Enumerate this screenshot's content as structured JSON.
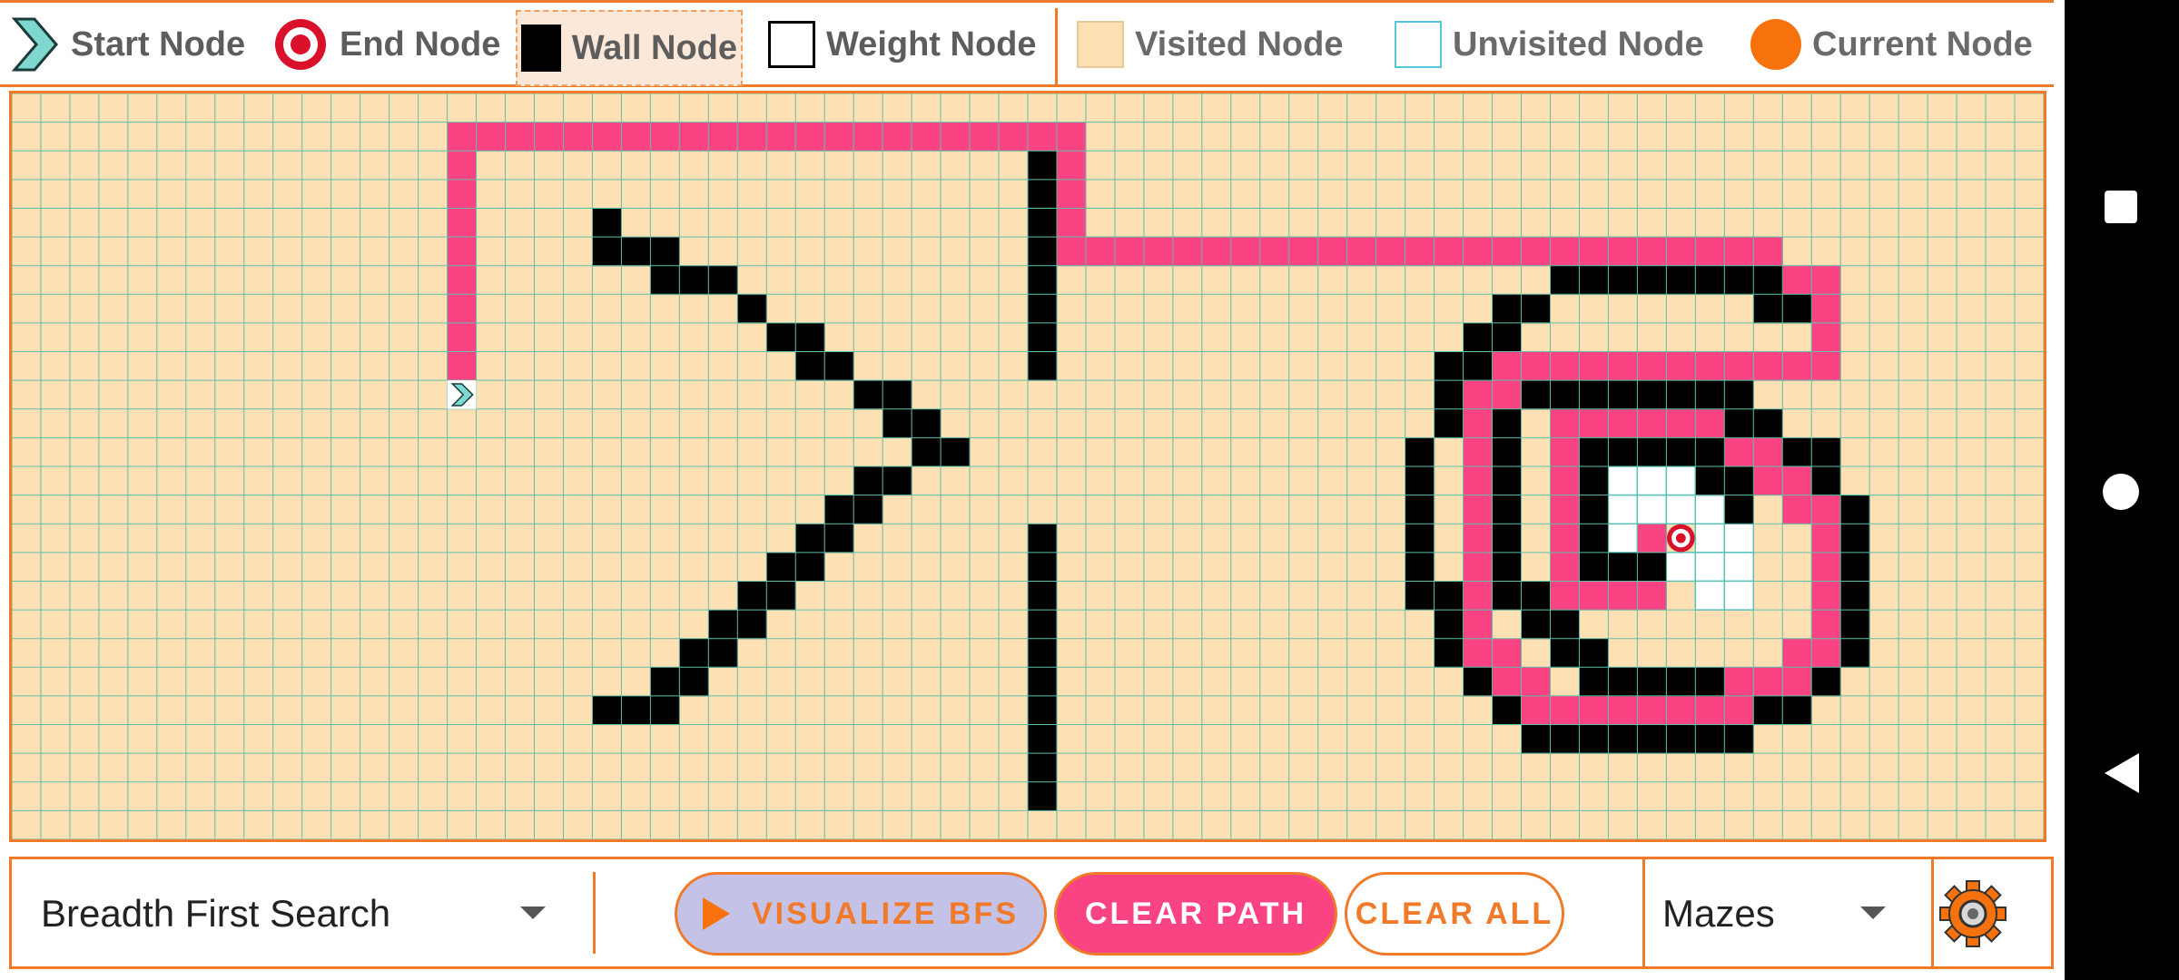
{
  "legend": {
    "start_label": "Start Node",
    "end_label": "End Node",
    "wall_label": "Wall Node",
    "weight_label": "Weight Node",
    "visited_label": "Visited Node",
    "unvisited_label": "Unvisited Node",
    "current_label": "Current Node"
  },
  "colors": {
    "accent": "#f07a2a",
    "visited": "#fde1b4",
    "unvisited_border": "#55c8d8",
    "grid_line": "#5fbfa9",
    "wall": "#000000",
    "path": "#f94383",
    "current": "#f7720c",
    "target": "#d9112b",
    "start": "#7fd8d0"
  },
  "board": {
    "cols": 70,
    "rows": 26,
    "start": [
      15,
      10
    ],
    "end": [
      57,
      15
    ],
    "walls": [
      [
        35,
        2
      ],
      [
        35,
        3
      ],
      [
        35,
        4
      ],
      [
        35,
        5
      ],
      [
        35,
        6
      ],
      [
        35,
        7
      ],
      [
        35,
        8
      ],
      [
        35,
        9
      ],
      [
        35,
        15
      ],
      [
        35,
        16
      ],
      [
        35,
        17
      ],
      [
        35,
        18
      ],
      [
        35,
        19
      ],
      [
        35,
        20
      ],
      [
        35,
        21
      ],
      [
        35,
        22
      ],
      [
        35,
        23
      ],
      [
        35,
        24
      ],
      [
        20,
        4
      ],
      [
        20,
        5
      ],
      [
        21,
        5
      ],
      [
        22,
        5
      ],
      [
        22,
        6
      ],
      [
        23,
        6
      ],
      [
        24,
        6
      ],
      [
        25,
        7
      ],
      [
        26,
        8
      ],
      [
        27,
        8
      ],
      [
        27,
        9
      ],
      [
        28,
        9
      ],
      [
        29,
        10
      ],
      [
        30,
        10
      ],
      [
        30,
        11
      ],
      [
        31,
        11
      ],
      [
        31,
        12
      ],
      [
        32,
        12
      ],
      [
        30,
        13
      ],
      [
        29,
        13
      ],
      [
        29,
        14
      ],
      [
        28,
        14
      ],
      [
        28,
        15
      ],
      [
        27,
        15
      ],
      [
        27,
        16
      ],
      [
        26,
        16
      ],
      [
        26,
        17
      ],
      [
        25,
        17
      ],
      [
        25,
        18
      ],
      [
        24,
        18
      ],
      [
        24,
        19
      ],
      [
        23,
        19
      ],
      [
        23,
        20
      ],
      [
        22,
        20
      ],
      [
        22,
        21
      ],
      [
        21,
        21
      ],
      [
        20,
        21
      ],
      [
        53,
        6
      ],
      [
        54,
        6
      ],
      [
        55,
        6
      ],
      [
        56,
        6
      ],
      [
        57,
        6
      ],
      [
        58,
        6
      ],
      [
        59,
        6
      ],
      [
        60,
        6
      ],
      [
        51,
        7
      ],
      [
        52,
        7
      ],
      [
        60,
        7
      ],
      [
        61,
        7
      ],
      [
        50,
        8
      ],
      [
        51,
        8
      ],
      [
        49,
        9
      ],
      [
        50,
        9
      ],
      [
        49,
        10
      ],
      [
        49,
        11
      ],
      [
        48,
        12
      ],
      [
        48,
        13
      ],
      [
        48,
        14
      ],
      [
        48,
        15
      ],
      [
        48,
        16
      ],
      [
        48,
        17
      ],
      [
        49,
        17
      ],
      [
        49,
        18
      ],
      [
        49,
        19
      ],
      [
        50,
        20
      ],
      [
        51,
        21
      ],
      [
        52,
        22
      ],
      [
        53,
        22
      ],
      [
        54,
        22
      ],
      [
        55,
        22
      ],
      [
        56,
        22
      ],
      [
        57,
        22
      ],
      [
        58,
        22
      ],
      [
        59,
        22
      ],
      [
        60,
        21
      ],
      [
        61,
        21
      ],
      [
        62,
        20
      ],
      [
        63,
        19
      ],
      [
        63,
        18
      ],
      [
        63,
        17
      ],
      [
        63,
        16
      ],
      [
        63,
        15
      ],
      [
        63,
        14
      ],
      [
        62,
        13
      ],
      [
        62,
        12
      ],
      [
        61,
        12
      ],
      [
        60,
        11
      ],
      [
        59,
        11
      ],
      [
        52,
        10
      ],
      [
        53,
        10
      ],
      [
        54,
        10
      ],
      [
        55,
        10
      ],
      [
        56,
        10
      ],
      [
        57,
        10
      ],
      [
        58,
        10
      ],
      [
        59,
        10
      ],
      [
        51,
        11
      ],
      [
        51,
        12
      ],
      [
        51,
        13
      ],
      [
        51,
        14
      ],
      [
        51,
        15
      ],
      [
        51,
        16
      ],
      [
        51,
        17
      ],
      [
        52,
        17
      ],
      [
        52,
        18
      ],
      [
        53,
        18
      ],
      [
        53,
        19
      ],
      [
        54,
        19
      ],
      [
        54,
        20
      ],
      [
        55,
        20
      ],
      [
        56,
        20
      ],
      [
        57,
        20
      ],
      [
        58,
        20
      ],
      [
        54,
        12
      ],
      [
        55,
        12
      ],
      [
        56,
        12
      ],
      [
        57,
        12
      ],
      [
        58,
        12
      ],
      [
        54,
        13
      ],
      [
        54,
        14
      ],
      [
        54,
        15
      ],
      [
        54,
        16
      ],
      [
        55,
        16
      ],
      [
        56,
        16
      ],
      [
        58,
        13
      ],
      [
        59,
        13
      ],
      [
        59,
        14
      ]
    ],
    "visited_cells": [
      [
        55,
        13
      ],
      [
        56,
        13
      ],
      [
        57,
        13
      ],
      [
        55,
        14
      ],
      [
        56,
        14
      ],
      [
        57,
        14
      ],
      [
        58,
        14
      ],
      [
        55,
        15
      ],
      [
        56,
        15
      ],
      [
        58,
        15
      ],
      [
        59,
        15
      ],
      [
        57,
        16
      ],
      [
        58,
        16
      ],
      [
        59,
        16
      ],
      [
        58,
        17
      ],
      [
        59,
        17
      ]
    ],
    "path": [
      [
        15,
        9
      ],
      [
        15,
        8
      ],
      [
        15,
        7
      ],
      [
        15,
        6
      ],
      [
        15,
        5
      ],
      [
        15,
        4
      ],
      [
        15,
        3
      ],
      [
        15,
        2
      ],
      [
        15,
        1
      ],
      [
        16,
        1
      ],
      [
        17,
        1
      ],
      [
        18,
        1
      ],
      [
        19,
        1
      ],
      [
        20,
        1
      ],
      [
        21,
        1
      ],
      [
        22,
        1
      ],
      [
        23,
        1
      ],
      [
        24,
        1
      ],
      [
        25,
        1
      ],
      [
        26,
        1
      ],
      [
        27,
        1
      ],
      [
        28,
        1
      ],
      [
        29,
        1
      ],
      [
        30,
        1
      ],
      [
        31,
        1
      ],
      [
        32,
        1
      ],
      [
        33,
        1
      ],
      [
        34,
        1
      ],
      [
        35,
        1
      ],
      [
        36,
        1
      ],
      [
        36,
        2
      ],
      [
        36,
        3
      ],
      [
        36,
        4
      ],
      [
        36,
        5
      ],
      [
        37,
        5
      ],
      [
        38,
        5
      ],
      [
        39,
        5
      ],
      [
        40,
        5
      ],
      [
        41,
        5
      ],
      [
        42,
        5
      ],
      [
        43,
        5
      ],
      [
        44,
        5
      ],
      [
        45,
        5
      ],
      [
        46,
        5
      ],
      [
        47,
        5
      ],
      [
        48,
        5
      ],
      [
        49,
        5
      ],
      [
        50,
        5
      ],
      [
        51,
        5
      ],
      [
        52,
        5
      ],
      [
        53,
        5
      ],
      [
        54,
        5
      ],
      [
        55,
        5
      ],
      [
        56,
        5
      ],
      [
        57,
        5
      ],
      [
        58,
        5
      ],
      [
        59,
        5
      ],
      [
        60,
        5
      ],
      [
        60,
        6
      ],
      [
        61,
        6
      ],
      [
        62,
        6
      ],
      [
        62,
        7
      ],
      [
        62,
        8
      ],
      [
        62,
        9
      ],
      [
        61,
        9
      ],
      [
        60,
        9
      ],
      [
        59,
        9
      ],
      [
        58,
        9
      ],
      [
        57,
        9
      ],
      [
        56,
        9
      ],
      [
        55,
        9
      ],
      [
        54,
        9
      ],
      [
        53,
        9
      ],
      [
        52,
        9
      ],
      [
        51,
        9
      ],
      [
        51,
        10
      ],
      [
        50,
        10
      ],
      [
        50,
        11
      ],
      [
        50,
        12
      ],
      [
        50,
        13
      ],
      [
        50,
        14
      ],
      [
        50,
        15
      ],
      [
        50,
        16
      ],
      [
        50,
        17
      ],
      [
        50,
        18
      ],
      [
        50,
        19
      ],
      [
        51,
        19
      ],
      [
        51,
        20
      ],
      [
        52,
        20
      ],
      [
        52,
        21
      ],
      [
        53,
        21
      ],
      [
        54,
        21
      ],
      [
        55,
        21
      ],
      [
        56,
        21
      ],
      [
        57,
        21
      ],
      [
        58,
        21
      ],
      [
        59,
        21
      ],
      [
        59,
        20
      ],
      [
        60,
        20
      ],
      [
        61,
        20
      ],
      [
        61,
        19
      ],
      [
        62,
        19
      ],
      [
        62,
        18
      ],
      [
        62,
        17
      ],
      [
        62,
        16
      ],
      [
        62,
        15
      ],
      [
        62,
        14
      ],
      [
        61,
        14
      ],
      [
        61,
        13
      ],
      [
        60,
        13
      ],
      [
        60,
        12
      ],
      [
        59,
        12
      ],
      [
        58,
        11
      ],
      [
        57,
        11
      ],
      [
        56,
        11
      ],
      [
        55,
        11
      ],
      [
        54,
        11
      ],
      [
        53,
        11
      ],
      [
        53,
        12
      ],
      [
        53,
        13
      ],
      [
        53,
        14
      ],
      [
        53,
        15
      ],
      [
        53,
        16
      ],
      [
        53,
        17
      ],
      [
        54,
        17
      ],
      [
        55,
        17
      ],
      [
        56,
        17
      ],
      [
        56,
        16
      ],
      [
        56,
        15
      ]
    ]
  },
  "toolbar": {
    "algorithm": "Breadth First Search",
    "visualize_label": "VISUALIZE BFS",
    "clear_path_label": "CLEAR PATH",
    "clear_all_label": "CLEAR ALL",
    "maze_label": "Mazes"
  },
  "icons": {
    "start": "chevron-right-icon",
    "end": "target-icon",
    "settings": "gear-icon",
    "play": "play-icon",
    "dropdown": "chevron-down-icon"
  }
}
